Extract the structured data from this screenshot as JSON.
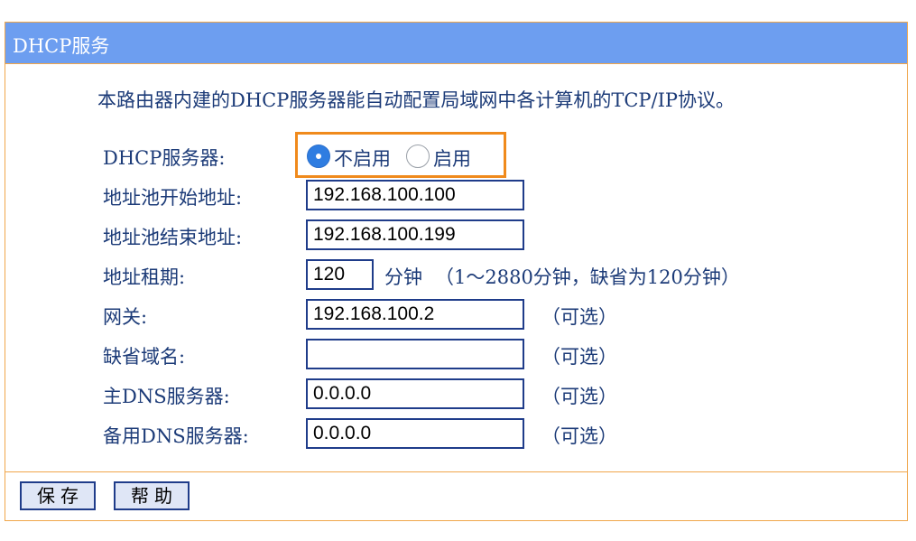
{
  "header": {
    "title": "DHCP服务"
  },
  "description": "本路由器内建的DHCP服务器能自动配置局域网中各计算机的TCP/IP协议。",
  "dhcp_server": {
    "label": "DHCP服务器:",
    "options": [
      "不启用",
      "启用"
    ],
    "selected": "不启用"
  },
  "fields": {
    "pool_start": {
      "label": "地址池开始地址:",
      "value": "192.168.100.100"
    },
    "pool_end": {
      "label": "地址池结束地址:",
      "value": "192.168.100.199"
    },
    "lease": {
      "label": "地址租期:",
      "value": "120",
      "unit": "分钟",
      "hint": "（1～2880分钟，缺省为120分钟）"
    },
    "gateway": {
      "label": "网关:",
      "value": "192.168.100.2",
      "hint": "（可选）"
    },
    "domain": {
      "label": "缺省域名:",
      "value": "",
      "hint": "（可选）"
    },
    "primary_dns": {
      "label": "主DNS服务器:",
      "value": "0.0.0.0",
      "hint": "（可选）"
    },
    "secondary_dns": {
      "label": "备用DNS服务器:",
      "value": "0.0.0.0",
      "hint": "（可选）"
    }
  },
  "buttons": {
    "save": "保存",
    "help": "帮助"
  },
  "colors": {
    "title_bar": "#6d9ef0",
    "border": "#f0a64a",
    "highlight": "#f08a1c",
    "text": "#1c3b78",
    "radio_selected": "#2f7de1"
  }
}
